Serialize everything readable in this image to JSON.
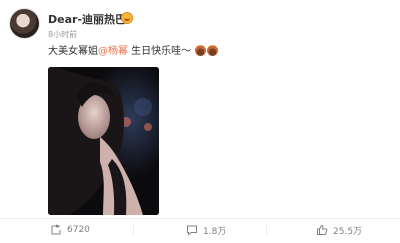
{
  "post": {
    "author": "Dear-迪丽热巴",
    "time": "8小时前",
    "text_before": "大美女幂姐",
    "mention": "@杨幂",
    "text_after": " 生日快乐哇～"
  },
  "actions": {
    "repost": "6720",
    "comment": "1.8万",
    "like": "25.5万"
  },
  "colors": {
    "mention": "#eb7350",
    "meta": "#999999",
    "icon": "#808080"
  }
}
